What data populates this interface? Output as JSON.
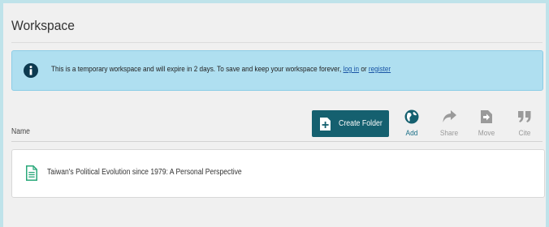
{
  "workspace": {
    "title": "Workspace"
  },
  "alert": {
    "message": "This is a temporary workspace and will expire in 2 days. To save and keep your workspace forever,",
    "login_link": "log in",
    "or_text": "or",
    "register_link": "register",
    "icon": "info-circle-icon"
  },
  "list_header": {
    "name_label": "Name"
  },
  "toolbar": {
    "create_folder_label": "Create Folder",
    "add_label": "Add",
    "share_label": "Share",
    "move_label": "Move",
    "cite_label": "Cite"
  },
  "files": [
    {
      "name": "Taiwan's Political Evolution since 1979: A Personal Perspective",
      "icon": "document-icon"
    }
  ],
  "colors": {
    "accent": "#15606f",
    "link": "#1a55a5",
    "alert_bg": "#afdff0",
    "file_icon": "#2aa87a"
  }
}
